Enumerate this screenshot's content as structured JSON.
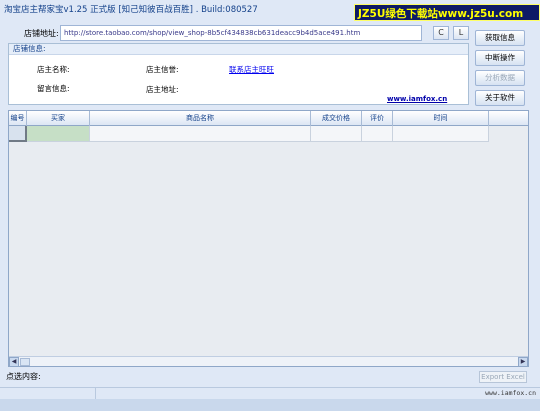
{
  "window": {
    "title": "淘宝店主帮家宝v1.25  正式版 [知己知彼百战百胜] . Build:080527"
  },
  "watermark": {
    "text": "JZ5U绿色下载站www.jz5u.com"
  },
  "url": {
    "label": "店铺地址:",
    "value": "http://store.taobao.com/shop/view_shop-8b5cf434838cb631deacc9b4d5ace491.htm"
  },
  "small_buttons": {
    "refresh": "C",
    "go": "L"
  },
  "info": {
    "header": "店铺信息:",
    "owner_name_label": "店主名称:",
    "owner_credit_label": "店主信誉:",
    "contact_link": "联系店主旺旺",
    "message_label": "留言信息:",
    "owner_address_label": "店主地址:",
    "site_link": "www.iamfox.cn"
  },
  "side_buttons": {
    "fetch": "获取信息",
    "stop": "中断操作",
    "analyze": "分析数据",
    "about": "关于软件"
  },
  "grid": {
    "columns": [
      "编号",
      "买家",
      "商品名称",
      "成交价格",
      "评价",
      "时间"
    ]
  },
  "bottom": {
    "selected_label": "点选内容:",
    "export_label": "Export Excel"
  },
  "status": {
    "text": "www.iamfox.cn"
  }
}
